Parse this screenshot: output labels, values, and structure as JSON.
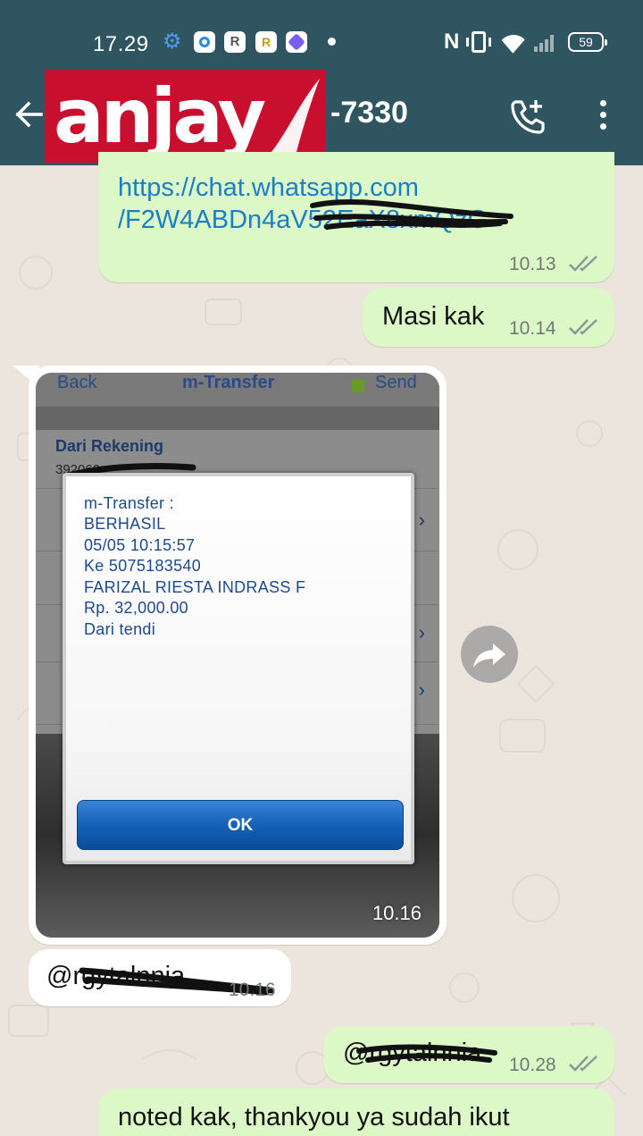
{
  "status_bar": {
    "time": "17.29",
    "battery": "59"
  },
  "header": {
    "logo_text": "anjay",
    "contact_suffix": "-7330"
  },
  "messages": [
    {
      "type": "link",
      "line1": "https://chat.whatsapp.com",
      "line2": "/F2W4ABDn4aV52EaX8xmQzG",
      "time": "10.13"
    },
    {
      "type": "text",
      "text": "Masi kak",
      "time": "10.14"
    },
    {
      "type": "image",
      "time": "10.16",
      "screenshot": {
        "header_left": "Back",
        "header_title": "m-Transfer",
        "header_right": "Send",
        "from_label": "Dari Rekening",
        "from_value": "392060",
        "dialog_lines": [
          "m-Transfer :",
          "BERHASIL",
          "05/05 10:15:57",
          "Ke 5075183540",
          "FARIZAL RIESTA INDRASS F",
          "Rp. 32,000.00",
          "Dari tendi"
        ],
        "ok_label": "OK"
      }
    },
    {
      "type": "text",
      "text": "@rgytalnnia",
      "time": "10.16"
    },
    {
      "type": "text",
      "text": "@rgytalnnia",
      "time": "10.28"
    },
    {
      "type": "text",
      "text": "noted kak, thankyou ya sudah ikut"
    }
  ],
  "colors": {
    "app_bar": "#2f5560",
    "outgoing_bubble": "#dcf8c6",
    "incoming_bubble": "#ffffff",
    "link": "#1a7fc9",
    "chat_bg": "#ece5dd",
    "logo_bg": "#c8102e"
  },
  "icons": {
    "back": "arrow-left-icon",
    "call": "add-call-icon",
    "menu": "more-vert-icon",
    "forward": "forward-icon",
    "read": "double-check-icon"
  }
}
